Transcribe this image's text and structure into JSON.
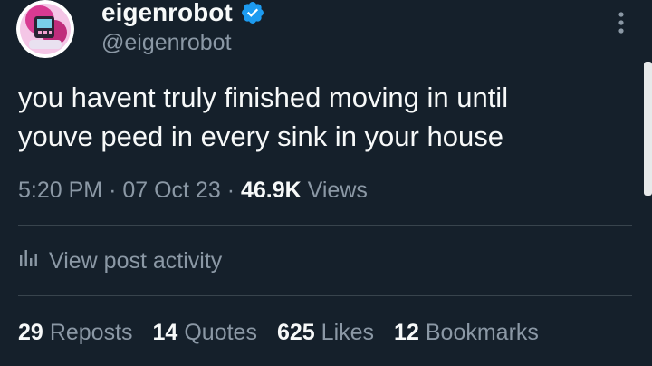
{
  "author": {
    "name": "eigenrobot",
    "handle": "@eigenrobot",
    "verified": true
  },
  "post": {
    "lines": [
      "you havent truly finished moving in until",
      "youve peed in every sink in your house"
    ]
  },
  "meta": {
    "time": "5:20 PM",
    "sep1": "·",
    "date": "07 Oct 23",
    "sep2": "·",
    "views_count": "46.9K",
    "views_label": "Views"
  },
  "activity": {
    "label": "View post activity"
  },
  "stats": [
    {
      "count": "29",
      "label": "Reposts"
    },
    {
      "count": "14",
      "label": "Quotes"
    },
    {
      "count": "625",
      "label": "Likes"
    },
    {
      "count": "12",
      "label": "Bookmarks"
    }
  ],
  "colors": {
    "background": "#15202b",
    "text": "#f7f9f9",
    "secondary": "#8b98a5",
    "verified": "#1d9bf0",
    "divider": "#38444d"
  },
  "icons": {
    "verified": "verified-badge-icon",
    "more": "more-vertical-icon",
    "activity": "bar-chart-icon"
  }
}
